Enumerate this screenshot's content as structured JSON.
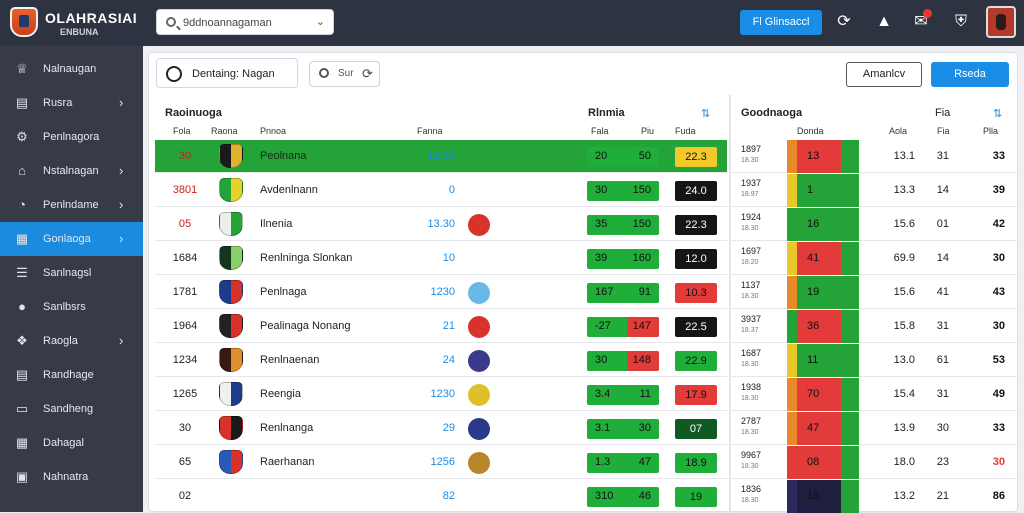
{
  "app": {
    "brand_title": "OLAHRASIAI",
    "brand_sub": "ENBUNA"
  },
  "search": {
    "value": "9ddnoannagaman"
  },
  "topbar": {
    "action_label": "Fl Glinsaccl"
  },
  "sidebar": {
    "items": [
      {
        "label": "Nalnaugan",
        "icon": "trophy-icon",
        "caret": false,
        "active": false
      },
      {
        "label": "Rusra",
        "icon": "table-icon",
        "caret": true,
        "active": false
      },
      {
        "label": "Penlnagora",
        "icon": "settings-icon",
        "caret": false,
        "active": false
      },
      {
        "label": "Nstalnagan",
        "icon": "home-icon",
        "caret": true,
        "active": false
      },
      {
        "label": "Penlndame",
        "icon": "chart-icon",
        "caret": true,
        "active": false
      },
      {
        "label": "Gonlaoga",
        "icon": "grid-icon",
        "caret": true,
        "active": true
      },
      {
        "label": "Sanlnagsl",
        "icon": "list-icon",
        "caret": false,
        "active": false
      },
      {
        "label": "Sanlbsrs",
        "icon": "globe-icon",
        "caret": false,
        "active": false
      },
      {
        "label": "Raogla",
        "icon": "puzzle-icon",
        "caret": true,
        "active": false
      },
      {
        "label": "Randhage",
        "icon": "doc-icon",
        "caret": false,
        "active": false
      },
      {
        "label": "Sandheng",
        "icon": "monitor-icon",
        "caret": false,
        "active": false
      },
      {
        "label": "Dahagal",
        "icon": "calendar-icon",
        "caret": false,
        "active": false
      },
      {
        "label": "Nahnatra",
        "icon": "image-icon",
        "caret": false,
        "active": false
      }
    ]
  },
  "panel": {
    "tab_label": "Dentaing: Nagan",
    "filter_label": "Sur",
    "btn_outline": "Amanlcv",
    "btn_primary": "Rseda"
  },
  "table": {
    "title": "Raoinuoga",
    "cols": [
      "Fola",
      "Raona",
      "Pnnoa",
      "Fanna"
    ],
    "right_title": "Rlnmia",
    "right_cols": [
      "Fala",
      "Piu",
      "Fuda"
    ],
    "rows": [
      {
        "rank": "30",
        "name": "Peolnana",
        "val": "13.30",
        "a": "20",
        "b": "50",
        "pill": "22.3",
        "pill_style": "yellow",
        "crest": [
          "#1a1a1a",
          "#e0b32a"
        ],
        "icon2": null,
        "red_frac": 0,
        "highlight": true
      },
      {
        "rank": "3801",
        "name": "Avdenlnann",
        "val": "0",
        "a": "30",
        "b": "150",
        "pill": "24.0",
        "pill_style": "black",
        "crest": [
          "#23a338",
          "#e8d22a"
        ],
        "icon2": null,
        "red_frac": 0,
        "highlight": false
      },
      {
        "rank": "05",
        "name": "Ilnenia",
        "val": "13.30",
        "a": "35",
        "b": "150",
        "pill": "22.3",
        "pill_style": "black",
        "crest": [
          "#e8f0e8",
          "#23a338"
        ],
        "icon2": "#d8322a",
        "red_frac": 0,
        "highlight": false
      },
      {
        "rank": "1684",
        "name": "Renlninga Slonkan",
        "val": "10",
        "a": "39",
        "b": "160",
        "pill": "12.0",
        "pill_style": "black",
        "crest": [
          "#15351c",
          "#8ad06a"
        ],
        "icon2": null,
        "red_frac": 0,
        "highlight": false
      },
      {
        "rank": "1781",
        "name": "Penlnaga",
        "val": "1230",
        "a": "167",
        "b": "91",
        "pill": "10.3",
        "pill_style": "red",
        "crest": [
          "#1e3a8a",
          "#d8322a"
        ],
        "icon2": "#6ab8e8",
        "red_frac": 0,
        "highlight": false
      },
      {
        "rank": "1964",
        "name": "Pealinaga Nonang",
        "val": "21",
        "a": "-27",
        "b": "147",
        "pill": "22.5",
        "pill_style": "black",
        "crest": [
          "#222222",
          "#d8322a"
        ],
        "icon2": "#d8322a",
        "red_frac": 0.45,
        "highlight": false
      },
      {
        "rank": "1234",
        "name": "Renlnaenan",
        "val": "24",
        "a": "30",
        "b": "148",
        "pill": "22.9",
        "pill_style": "green",
        "crest": [
          "#3a1a10",
          "#e0902a"
        ],
        "icon2": "#3a3a8a",
        "red_frac": 0.45,
        "highlight": false
      },
      {
        "rank": "1265",
        "name": "Reengia",
        "val": "1230",
        "a": "3.4",
        "b": "11",
        "pill": "17.9",
        "pill_style": "red",
        "crest": [
          "#f0f0f0",
          "#1e3a8a"
        ],
        "icon2": "#e0c02a",
        "red_frac": 0,
        "highlight": false
      },
      {
        "rank": "30",
        "name": "Renlnanga",
        "val": "29",
        "a": "3.1",
        "b": "30",
        "pill": "07",
        "pill_style": "darkgreen",
        "crest": [
          "#d8322a",
          "#1a1a1a"
        ],
        "icon2": "#2a3a8a",
        "red_frac": 0,
        "highlight": false
      },
      {
        "rank": "65",
        "name": "Raerhanan",
        "val": "1256",
        "a": "1.3",
        "b": "47",
        "pill": "18.9",
        "pill_style": "green",
        "crest": [
          "#2a5ab8",
          "#d8322a"
        ],
        "icon2": "#b8862a",
        "red_frac": 0,
        "highlight": false
      },
      {
        "rank": "02",
        "name": "",
        "val": "82",
        "a": "310",
        "b": "46",
        "pill": "19",
        "pill_style": "green",
        "crest": null,
        "icon2": null,
        "red_frac": 0,
        "highlight": false
      }
    ]
  },
  "right": {
    "title": "Goodnaoga",
    "cols": [
      "Donda",
      "Aola",
      "Fia",
      "Plla"
    ],
    "rows": [
      {
        "date": "1897",
        "sub": "18.30",
        "strip": "#e88a2a",
        "form": "13",
        "form_bg": "#e33a3a",
        "a": "13.1",
        "b": "31",
        "c": "33",
        "c_color": "#111"
      },
      {
        "date": "1937",
        "sub": "18.97",
        "strip": "#e8c82a",
        "form": "1",
        "form_bg": "#23a338",
        "a": "13.3",
        "b": "14",
        "c": "39",
        "c_color": "#111"
      },
      {
        "date": "1924",
        "sub": "18.30",
        "strip": "#23a338",
        "form": "16",
        "form_bg": "#23a338",
        "a": "15.6",
        "b": "01",
        "c": "42",
        "c_color": "#111"
      },
      {
        "date": "1697",
        "sub": "18.20",
        "strip": "#e8c82a",
        "form": "41",
        "form_bg": "#e33a3a",
        "a": "69.9",
        "b": "14",
        "c": "30",
        "c_color": "#111"
      },
      {
        "date": "1137",
        "sub": "18.30",
        "strip": "#e88a2a",
        "form": "19",
        "form_bg": "#23a338",
        "a": "15.6",
        "b": "41",
        "c": "43",
        "c_color": "#111"
      },
      {
        "date": "3937",
        "sub": "18.37",
        "strip": "#23a338",
        "form": "36",
        "form_bg": "#e33a3a",
        "a": "15.8",
        "b": "31",
        "c": "30",
        "c_color": "#111"
      },
      {
        "date": "1687",
        "sub": "18.30",
        "strip": "#e8c82a",
        "form": "11",
        "form_bg": "#23a338",
        "a": "13.0",
        "b": "61",
        "c": "53",
        "c_color": "#111"
      },
      {
        "date": "1938",
        "sub": "18.30",
        "strip": "#e88a2a",
        "form": "70",
        "form_bg": "#e33a3a",
        "a": "15.4",
        "b": "31",
        "c": "49",
        "c_color": "#111"
      },
      {
        "date": "2787",
        "sub": "18.30",
        "strip": "#e88a2a",
        "form": "47",
        "form_bg": "#e33a3a",
        "a": "13.9",
        "b": "30",
        "c": "33",
        "c_color": "#111"
      },
      {
        "date": "9967",
        "sub": "18.30",
        "strip": "#e33a3a",
        "form": "08",
        "form_bg": "#e33a3a",
        "a": "18.0",
        "b": "23",
        "c": "30",
        "c_color": "#e33a3a"
      },
      {
        "date": "1836",
        "sub": "18.30",
        "strip": "#2a2a5a",
        "form": "16",
        "form_bg": "#1e1e3e",
        "a": "13.2",
        "b": "21",
        "c": "86",
        "c_color": "#111"
      }
    ]
  },
  "colors": {
    "accent": "#1a8ee6",
    "topbar": "#2d3340",
    "sidebar": "#363b47",
    "green": "#23a338",
    "red": "#e33a3a"
  }
}
